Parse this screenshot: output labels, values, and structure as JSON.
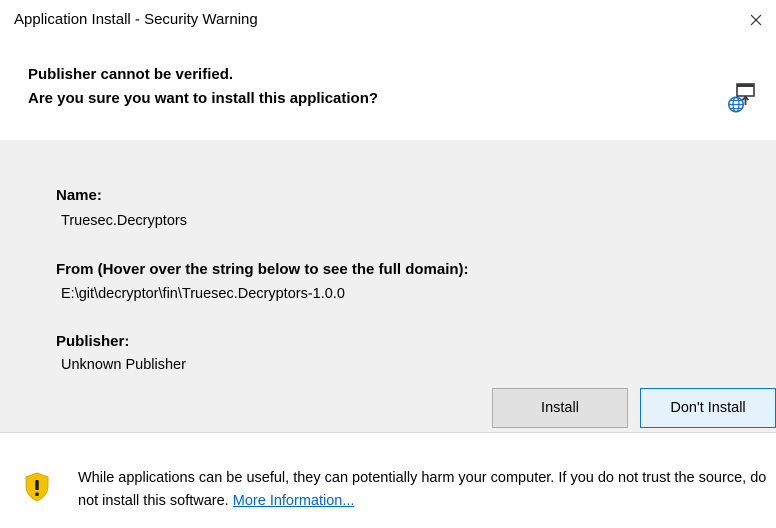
{
  "window": {
    "title": "Application Install - Security Warning",
    "close_icon": "close-icon"
  },
  "header": {
    "warning_line1": "Publisher cannot be verified.",
    "warning_line2": "Are you sure you want to install this application?",
    "icon": "web-application-icon"
  },
  "details": {
    "name_label": "Name:",
    "name_value": "Truesec.Decryptors",
    "from_label": "From (Hover over the string below to see the full domain):",
    "from_value": "E:\\git\\decryptor\\fin\\Truesec.Decryptors-1.0.0",
    "publisher_label": "Publisher:",
    "publisher_value": "Unknown Publisher"
  },
  "buttons": {
    "install_label": "Install",
    "dont_install_label": "Don't Install"
  },
  "footer": {
    "icon": "shield-warning-icon",
    "message": "While applications can be useful, they can potentially harm your computer. If you do not trust the source, do not install this software.",
    "link_label": "More Information..."
  },
  "colors": {
    "content_background": "#f0f0f0",
    "link": "#0066cc",
    "shield": "#f2c200",
    "focused_button_border": "#0078d7"
  }
}
